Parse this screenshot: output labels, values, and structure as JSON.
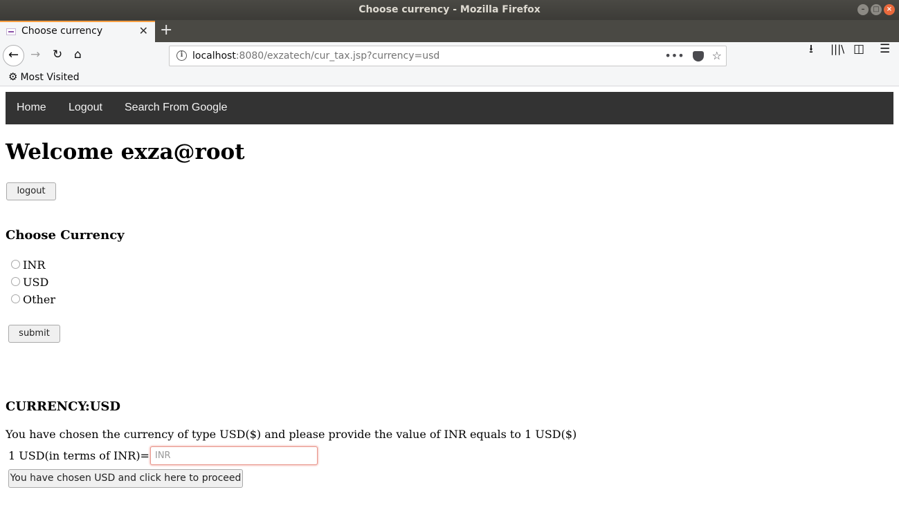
{
  "window": {
    "title": "Choose currency - Mozilla Firefox"
  },
  "browser": {
    "tab_title": "Choose currency",
    "url_host": "localhost",
    "url_rest": ":8080/exzatech/cur_tax.jsp?currency=usd",
    "bookmarks": [
      {
        "label": "Most Visited"
      }
    ]
  },
  "topnav": {
    "items": [
      "Home",
      "Logout",
      "Search From Google"
    ]
  },
  "page": {
    "welcome": "Welcome exza@root",
    "logout_button": "logout",
    "choose_heading": "Choose Currency",
    "currency_options": [
      "INR",
      "USD",
      "Other"
    ],
    "submit_button": "submit",
    "currency_heading": "CURRENCY:USD",
    "info_text": "You have chosen the currency of type USD($) and please provide the value of INR equals to 1 USD($)",
    "input_label": "1 USD(in terms of INR)=",
    "input_placeholder": "INR",
    "input_value": "",
    "proceed_button": "You have chosen USD and click here to proceed"
  }
}
